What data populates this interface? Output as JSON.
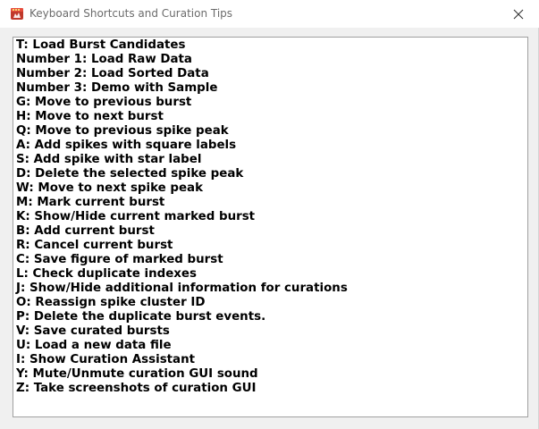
{
  "window": {
    "title": "Keyboard Shortcuts and Curation Tips",
    "icon": "matlab-app-icon",
    "close_icon": "close-icon"
  },
  "colors": {
    "titlebar_bg": "#ffffff",
    "title_text": "#6b6b6b",
    "client_bg": "#f0f0f0",
    "textbox_bg": "#ffffff",
    "textbox_border": "#a0a0a0"
  },
  "shortcuts": [
    "T: Load Burst Candidates",
    "Number 1: Load Raw Data",
    "Number 2: Load Sorted Data",
    "Number 3: Demo with Sample",
    "G: Move to previous burst",
    "H: Move to next burst",
    "Q: Move to previous spike peak",
    "A: Add spikes with square labels",
    "S: Add spike with star label",
    "D: Delete the selected spike peak",
    "W: Move to next spike peak",
    "M: Mark current burst",
    "K: Show/Hide current marked burst",
    "B: Add current burst",
    "R: Cancel current burst",
    "C: Save figure of marked burst",
    "L: Check duplicate indexes",
    "J: Show/Hide additional information for curations",
    "O: Reassign spike cluster ID",
    "P: Delete the duplicate burst events.",
    "V: Save curated bursts",
    "U: Load a new data file",
    "I: Show Curation Assistant",
    "Y: Mute/Unmute curation GUI sound",
    "Z: Take screenshots of curation GUI"
  ]
}
